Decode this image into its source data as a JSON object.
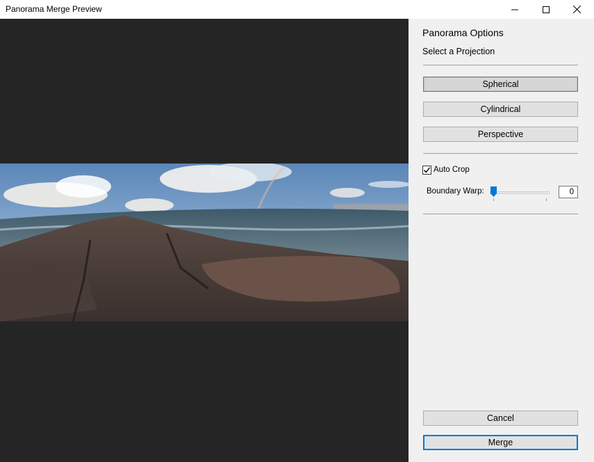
{
  "window": {
    "title": "Panorama Merge Preview",
    "controls": [
      "minimize-icon",
      "maximize-icon",
      "close-icon"
    ]
  },
  "preview": {
    "image": "panorama-preview-image",
    "background_color": "#252525"
  },
  "panel": {
    "title": "Panorama Options",
    "subtitle": "Select a Projection",
    "projections": [
      {
        "label": "Spherical",
        "selected": true
      },
      {
        "label": "Cylindrical",
        "selected": false
      },
      {
        "label": "Perspective",
        "selected": false
      }
    ],
    "auto_crop": {
      "label": "Auto Crop",
      "checked": true
    },
    "boundary_warp": {
      "label": "Boundary Warp:",
      "value": "0",
      "slider_fraction": 0
    },
    "cancel_label": "Cancel",
    "merge_label": "Merge",
    "accent_color": "#0078d7"
  }
}
